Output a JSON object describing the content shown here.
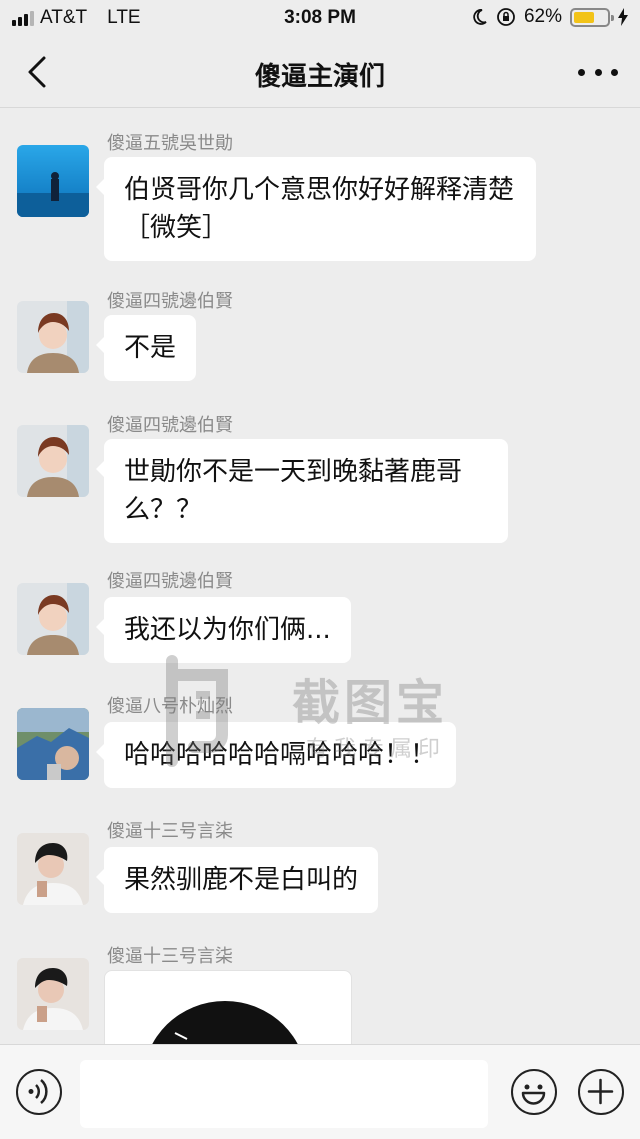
{
  "status_bar": {
    "carrier": "AT&T",
    "network": "LTE",
    "time": "3:08 PM",
    "battery_percent": "62%",
    "battery_level": 0.62,
    "battery_color": "#f2c318"
  },
  "header": {
    "title": "傻逼主演们"
  },
  "messages": [
    {
      "sender": "傻逼五號吳世勛",
      "text": "伯贤哥你几个意思你好好解释清楚［微笑］"
    },
    {
      "sender": "傻逼四號邊伯賢",
      "text": "不是"
    },
    {
      "sender": "傻逼四號邊伯賢",
      "text": "世勛你不是一天到晚黏著鹿哥么？？"
    },
    {
      "sender": "傻逼四號邊伯賢",
      "text": "我还以为你们俩..."
    },
    {
      "sender": "傻逼八号朴灿烈",
      "text": "哈哈哈哈哈哈嗝哈哈哈！！"
    },
    {
      "sender": "傻逼十三号言柒",
      "text": "果然驯鹿不是白叫的"
    },
    {
      "sender": "傻逼十三号言柒",
      "text": ""
    }
  ],
  "watermark": {
    "title": "截图宝",
    "subtitle": "有我专属印"
  },
  "input_bar": {
    "placeholder": ""
  },
  "icons": {
    "back": "chevron-left-icon",
    "more": "more-dots-icon",
    "voice": "voice-icon",
    "emoji": "emoji-icon",
    "plus": "plus-icon"
  },
  "colors": {
    "background": "#ededed",
    "bubble": "#ffffff",
    "sender_name": "#8a8a8a"
  }
}
